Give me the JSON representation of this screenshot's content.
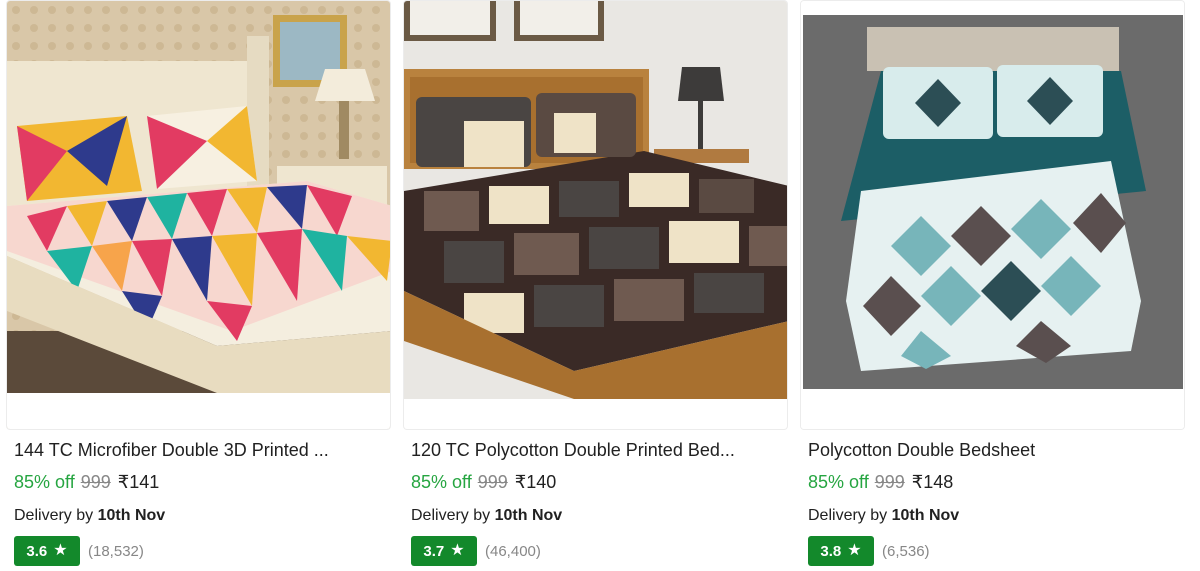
{
  "products": [
    {
      "title": "144 TC Microfiber Double 3D Printed ...",
      "discount": "85% off",
      "mrp": "999",
      "price": "₹141",
      "delivery_prefix": "Delivery by",
      "delivery_date": "10th Nov",
      "rating": "3.6",
      "reviews": "(18,532)",
      "image_icon": "bedsheet-triangle-print-image"
    },
    {
      "title": "120 TC Polycotton Double Printed Bed...",
      "discount": "85% off",
      "mrp": "999",
      "price": "₹140",
      "delivery_prefix": "Delivery by",
      "delivery_date": "10th Nov",
      "rating": "3.7",
      "reviews": "(46,400)",
      "image_icon": "bedsheet-brown-patchwork-image"
    },
    {
      "title": "Polycotton Double Bedsheet",
      "discount": "85% off",
      "mrp": "999",
      "price": "₹148",
      "delivery_prefix": "Delivery by",
      "delivery_date": "10th Nov",
      "rating": "3.8",
      "reviews": "(6,536)",
      "image_icon": "bedsheet-teal-diamond-image"
    }
  ],
  "colors": {
    "discount_green": "#26a541",
    "rating_green": "#13892b",
    "muted_gray": "#878787"
  },
  "star_glyph": "★"
}
